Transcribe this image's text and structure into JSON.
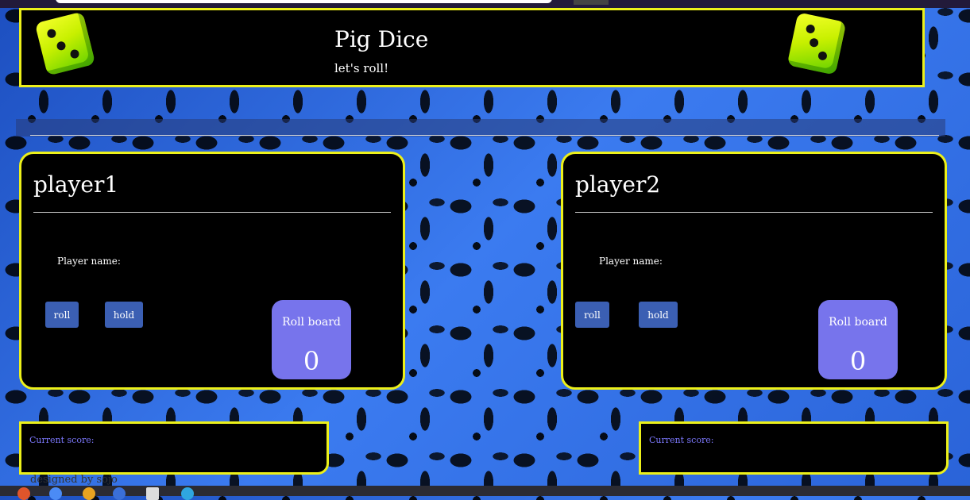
{
  "header": {
    "title": "Pig Dice",
    "subtitle": "let's roll!"
  },
  "players": [
    {
      "name": "player1",
      "name_label": "Player name:",
      "roll_label": "roll",
      "hold_label": "hold",
      "rollboard_label": "Roll board",
      "rollboard_value": "0",
      "current_score_label": "Current score:"
    },
    {
      "name": "player2",
      "name_label": "Player name:",
      "roll_label": "roll",
      "hold_label": "hold",
      "rollboard_label": "Roll board",
      "rollboard_value": "0",
      "current_score_label": "Current score:"
    }
  ],
  "footer": {
    "credit": "designed by sojo"
  },
  "colors": {
    "accent_border": "#ecf01a",
    "button": "#3b5fb3",
    "rollboard": "#7774ec",
    "score_label": "#7d79ff"
  },
  "icons": [
    "dice-icon",
    "dice-icon"
  ]
}
